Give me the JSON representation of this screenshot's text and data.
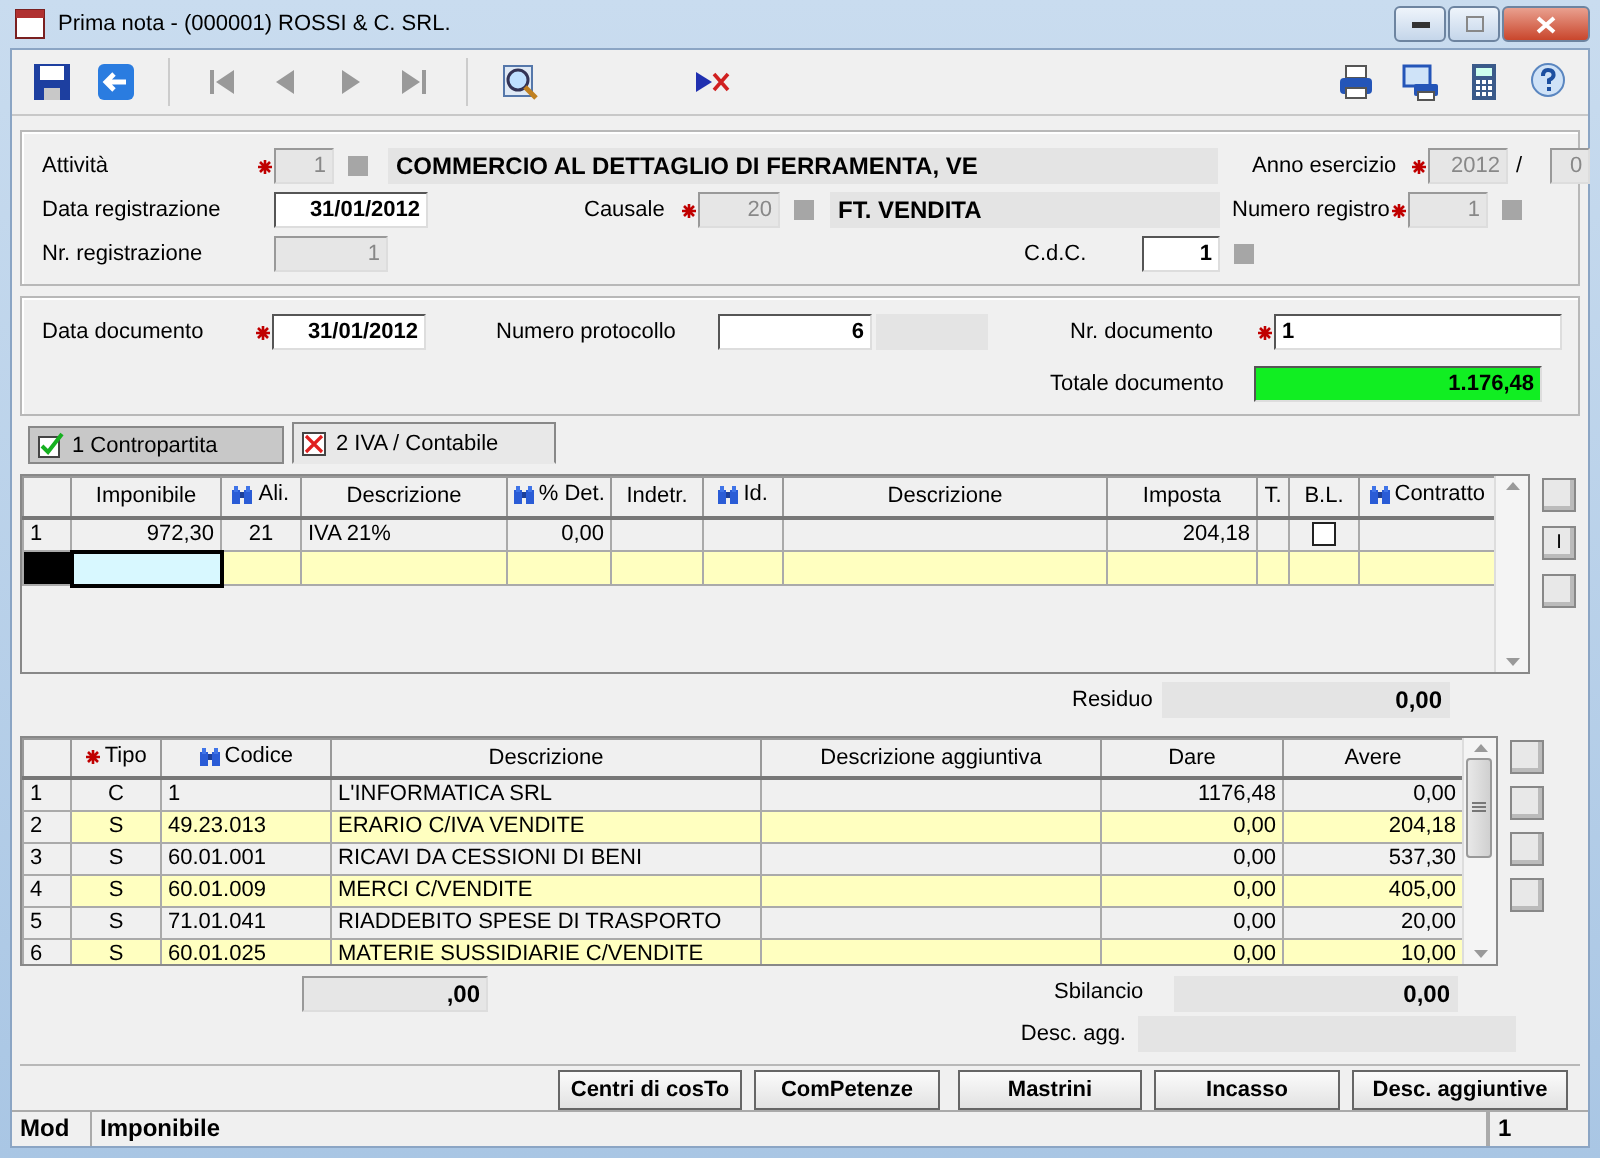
{
  "window": {
    "title": "Prima nota  -  (000001) ROSSI & C. SRL."
  },
  "header": {
    "fields": [
      {
        "kind": "field",
        "label": "Attività",
        "required": true,
        "value": "1",
        "disabled": true,
        "lookup": true
      },
      {
        "kind": "display",
        "value": "COMMERCIO AL DETTAGLIO DI FERRAMENTA, VE"
      },
      {
        "kind": "field",
        "label": "Anno esercizio",
        "required": true,
        "value": "2012",
        "disabled": true,
        "lookup": false
      },
      {
        "kind": "separator",
        "value": "/"
      },
      {
        "kind": "field",
        "required": false,
        "value": "0",
        "disabled": true,
        "lookup": false
      },
      {
        "kind": "field",
        "label": "Data registrazione",
        "required": false,
        "value": "31/01/2012",
        "disabled": false,
        "lookup": false
      },
      {
        "kind": "field",
        "label": "Causale",
        "required": true,
        "value": "20",
        "disabled": true,
        "lookup": true
      },
      {
        "kind": "display",
        "value": "FT. VENDITA"
      },
      {
        "kind": "field",
        "label": "Numero registro",
        "required": true,
        "value": "1",
        "disabled": true,
        "lookup": true
      },
      {
        "kind": "field",
        "label": "Nr. registrazione",
        "required": false,
        "value": "1",
        "disabled": true,
        "lookup": false
      },
      {
        "kind": "field",
        "label": "C.d.C.",
        "required": false,
        "value": "1",
        "disabled": false,
        "lookup": true
      }
    ]
  },
  "document": {
    "fields": [
      {
        "kind": "field",
        "label": "Data documento",
        "required": true,
        "value": "31/01/2012",
        "disabled": false,
        "lookup": false
      },
      {
        "kind": "field",
        "label": "Numero protocollo",
        "required": false,
        "value": "6",
        "disabled": false,
        "lookup": false
      },
      {
        "kind": "display"
      },
      {
        "kind": "field",
        "label": "Nr. documento",
        "required": true,
        "value": "1",
        "disabled": false,
        "lookup": false
      },
      {
        "kind": "total",
        "label": "Totale documento",
        "required": false,
        "value": "1.176,48",
        "disabled": false,
        "lookup": false
      }
    ]
  },
  "tabs": [
    {
      "label": "1 Contropartita",
      "selected": false,
      "complete": true
    },
    {
      "label": "2 IVA / Contabile",
      "selected": true,
      "complete": false
    }
  ],
  "vat_grid": {
    "columns": [
      {
        "label": "Imponibile",
        "kind": "number",
        "lookup": false
      },
      {
        "label": "Ali.",
        "kind": "center",
        "lookup": true
      },
      {
        "label": "Descrizione",
        "kind": "text",
        "lookup": false
      },
      {
        "label": "% Det.",
        "kind": "number",
        "lookup": true
      },
      {
        "label": "Indetr.",
        "kind": "text",
        "lookup": false
      },
      {
        "label": "Id.",
        "kind": "text",
        "lookup": true
      },
      {
        "label": "Descrizione",
        "kind": "text",
        "lookup": false
      },
      {
        "label": "Imposta",
        "kind": "number",
        "lookup": false
      },
      {
        "label": "T.",
        "kind": "text",
        "lookup": false
      },
      {
        "label": "B.L.",
        "kind": "checkbox",
        "lookup": false
      },
      {
        "label": "Contratto",
        "kind": "text",
        "lookup": true
      }
    ],
    "rows": [
      {
        "number": "1",
        "current": false,
        "cells": [
          "972,30",
          "21",
          "IVA 21%",
          "0,00",
          null,
          null,
          null,
          "204,18",
          null,
          false,
          null
        ]
      },
      {
        "current": true
      }
    ],
    "side_buttons": [
      {
        "kind": "blank"
      },
      {
        "kind": "text",
        "label": "I"
      },
      {
        "kind": "blank"
      }
    ],
    "residual": {
      "label": "Residuo",
      "value": "0,00"
    }
  },
  "entries_grid": {
    "columns": [
      {
        "label": "Tipo",
        "kind": "center",
        "required": true,
        "lookup": false
      },
      {
        "label": "Codice",
        "kind": "text",
        "required": false,
        "lookup": true
      },
      {
        "label": "Descrizione",
        "kind": "text",
        "required": false,
        "lookup": false
      },
      {
        "label": "Descrizione aggiuntiva",
        "kind": "text",
        "required": false,
        "lookup": false
      },
      {
        "label": "Dare",
        "kind": "number",
        "required": false,
        "lookup": false
      },
      {
        "label": "Avere",
        "kind": "number",
        "required": false,
        "lookup": false
      }
    ],
    "rows": [
      {
        "number": "1",
        "cells": [
          "C",
          "1",
          "L'INFORMATICA SRL",
          null,
          "1176,48",
          "0,00"
        ]
      },
      {
        "number": "2",
        "cells": [
          "S",
          "49.23.013",
          "ERARIO C/IVA VENDITE",
          null,
          "0,00",
          "204,18"
        ]
      },
      {
        "number": "3",
        "cells": [
          "S",
          "60.01.001",
          "RICAVI DA CESSIONI DI BENI",
          null,
          "0,00",
          "537,30"
        ]
      },
      {
        "number": "4",
        "cells": [
          "S",
          "60.01.009",
          "MERCI C/VENDITE",
          null,
          "0,00",
          "405,00"
        ]
      },
      {
        "number": "5",
        "cells": [
          "S",
          "71.01.041",
          "RIADDEBITO SPESE DI TRASPORTO",
          null,
          "0,00",
          "20,00"
        ]
      },
      {
        "number": "6",
        "cells": [
          "S",
          "60.01.025",
          "MATERIE SUSSIDIARIE C/VENDITE",
          null,
          "0,00",
          "10,00"
        ]
      }
    ],
    "side_buttons": [
      {
        "kind": "blank"
      },
      {
        "kind": "blank"
      },
      {
        "kind": "blank"
      },
      {
        "kind": "blank"
      }
    ],
    "sum": ",00",
    "imbalance": {
      "label": "Sbilancio",
      "value": "0,00"
    },
    "extra_desc": {
      "label": "Desc. agg."
    }
  },
  "buttons": [
    "Centri di cosTo",
    "ComPetenze",
    "Mastrini",
    "Incasso",
    "Desc. aggiuntive"
  ],
  "status_bar": {
    "mode": "Mod",
    "field": "Imponibile",
    "record": "1"
  }
}
